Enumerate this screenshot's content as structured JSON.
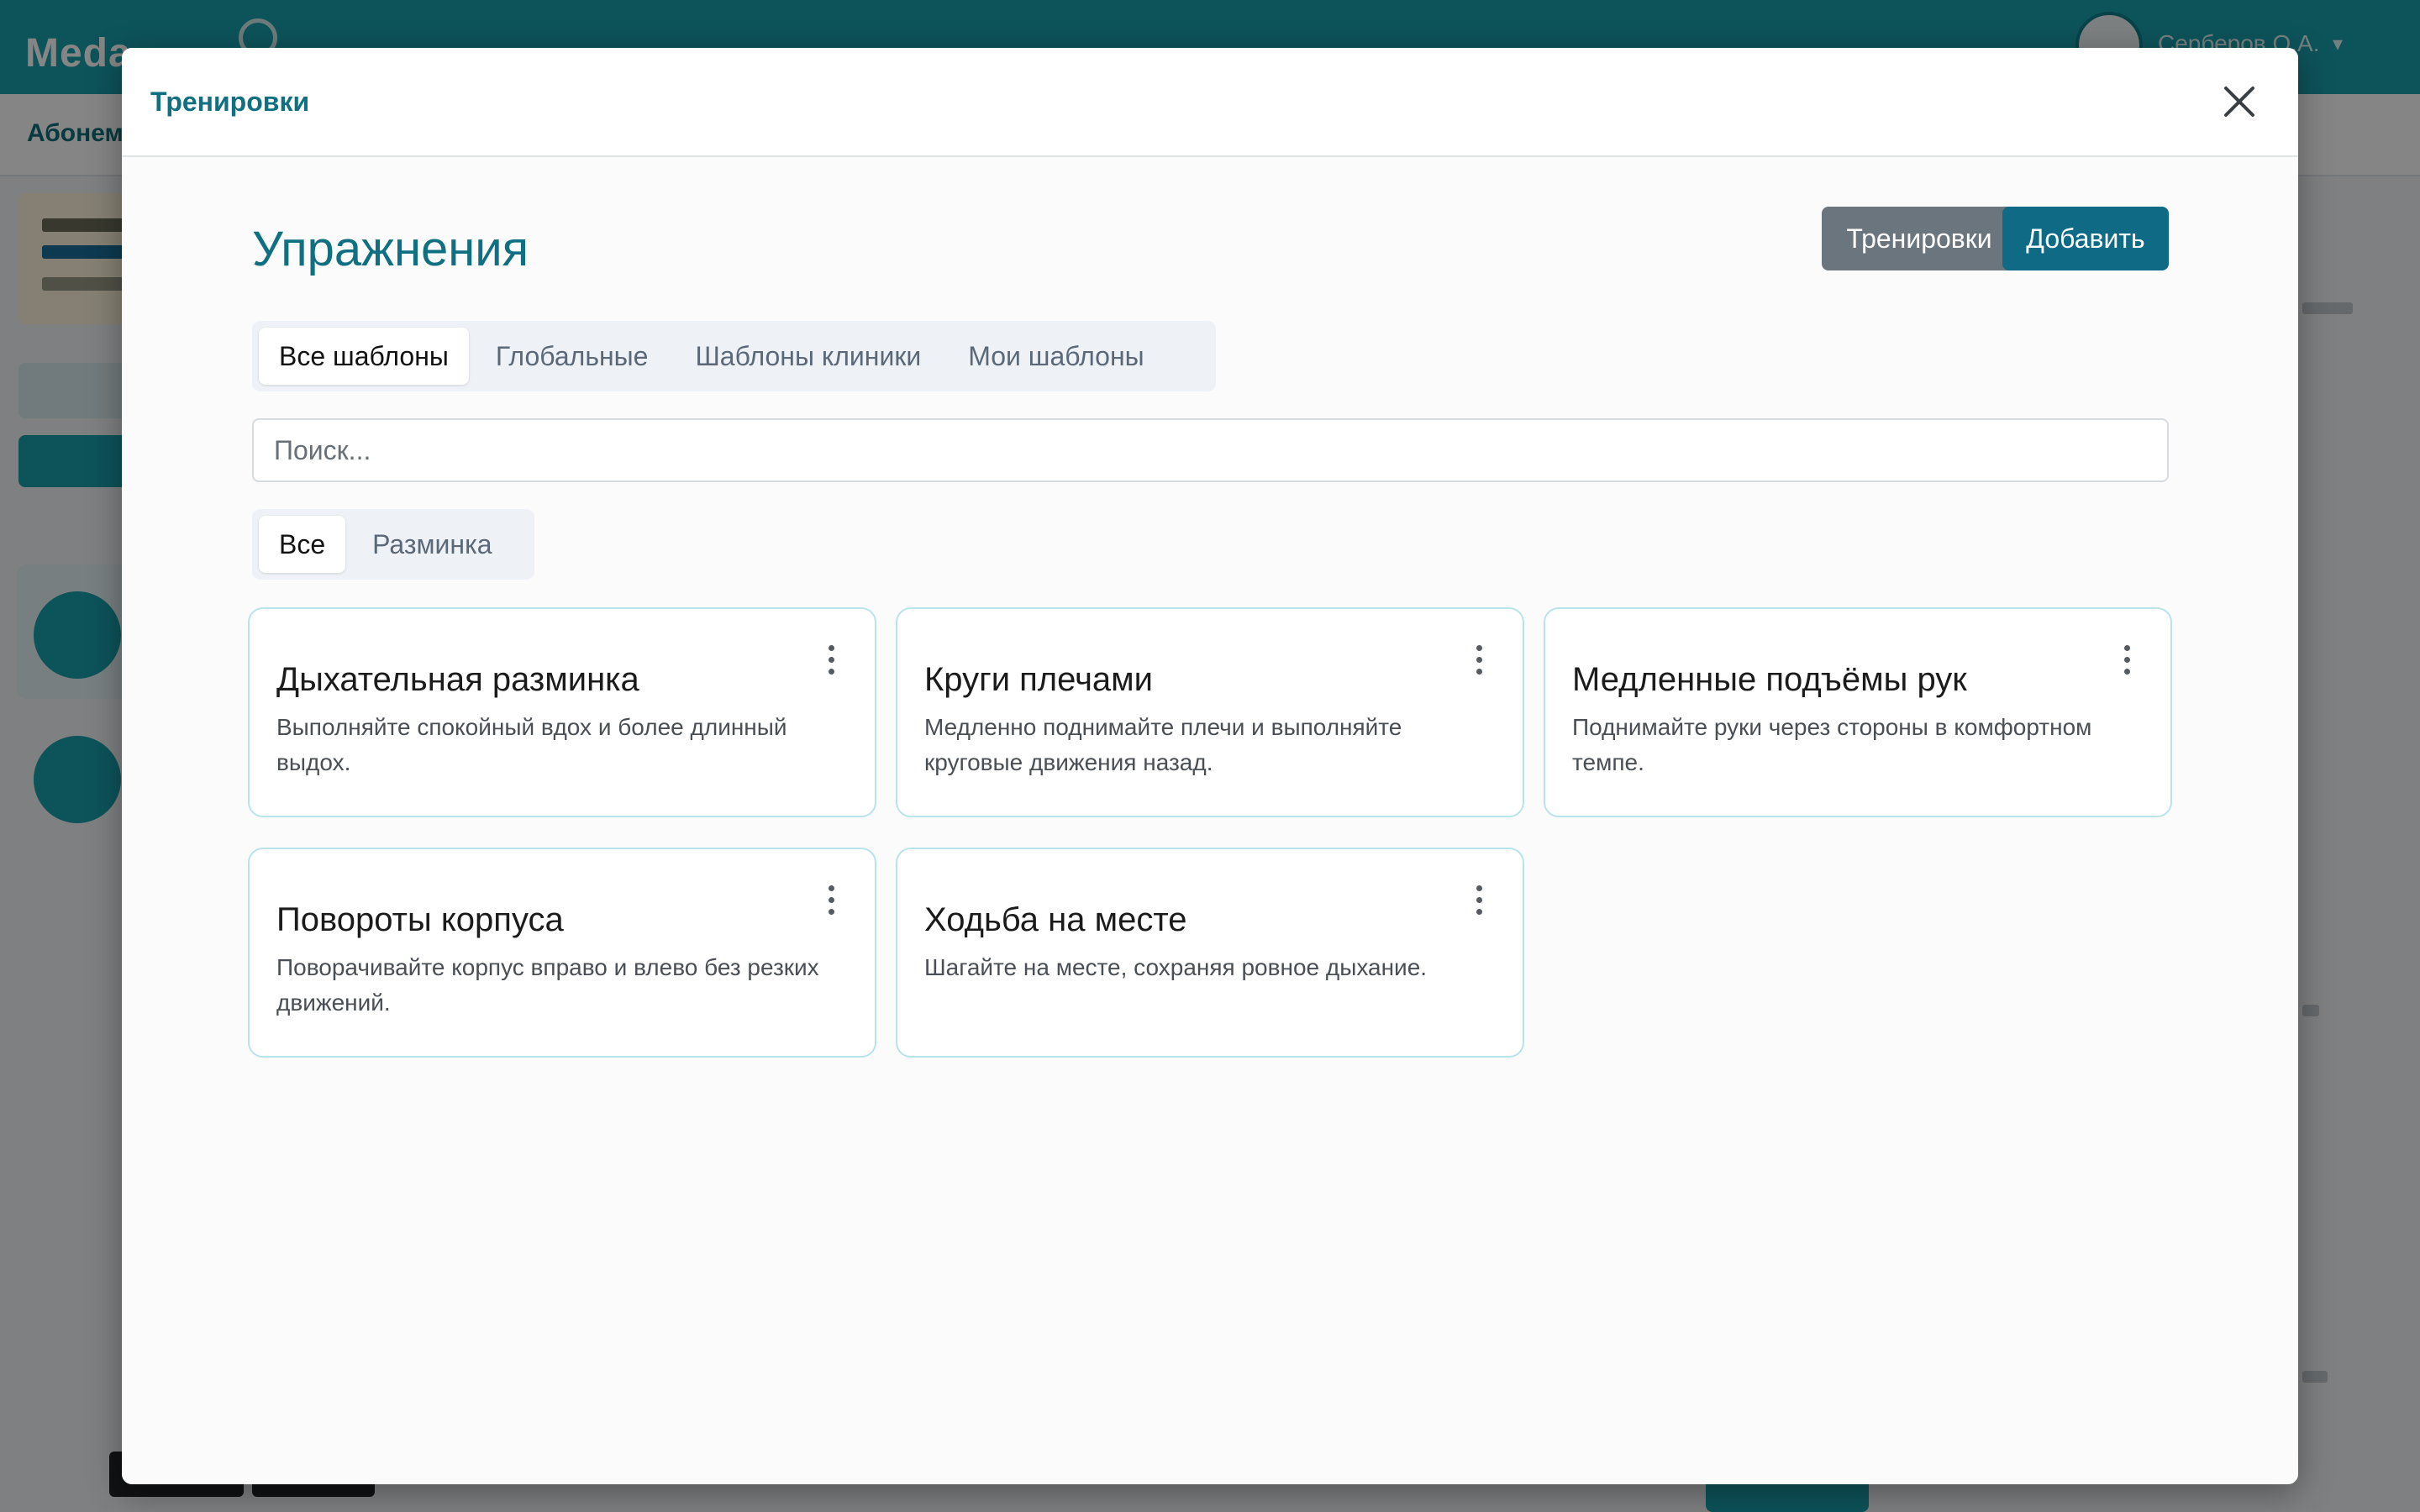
{
  "background": {
    "brand": "Meda",
    "subnav_label": "Абонем",
    "user_name": "Серберов О.А."
  },
  "modal": {
    "title": "Тренировки",
    "heading": "Упражнения",
    "buttons": {
      "trainings_label": "Тренировки",
      "add_label": "Добавить"
    },
    "template_tabs": [
      {
        "label": "Все шаблоны",
        "active": true
      },
      {
        "label": "Глобальные",
        "active": false
      },
      {
        "label": "Шаблоны клиники",
        "active": false
      },
      {
        "label": "Мои шаблоны",
        "active": false
      }
    ],
    "search": {
      "placeholder": "Поиск...",
      "value": ""
    },
    "category_tabs": [
      {
        "label": "Все",
        "active": true
      },
      {
        "label": "Разминка",
        "active": false
      }
    ],
    "exercises": [
      {
        "title": "Дыхательная разминка",
        "description": "Выполняйте спокойный вдох и более длинный выдох."
      },
      {
        "title": "Круги плечами",
        "description": "Медленно поднимайте плечи и выполняйте круговые движения назад."
      },
      {
        "title": "Медленные подъёмы рук",
        "description": "Поднимайте руки через стороны в комфортном темпе."
      },
      {
        "title": "Повороты корпуса",
        "description": "Поворачивайте корпус вправо и влево без резких движений."
      },
      {
        "title": "Ходьба на месте",
        "description": "Шагайте на месте, сохраняя ровное дыхание."
      }
    ]
  },
  "icons": {
    "close": "close-icon",
    "card_menu": "more-vertical-icon"
  },
  "colors": {
    "accent": "#106f80",
    "primary_button": "#0f6a86",
    "secondary_button": "#6b757d",
    "card_border": "#b9e3ea",
    "header_bg": "#1a9fac"
  }
}
